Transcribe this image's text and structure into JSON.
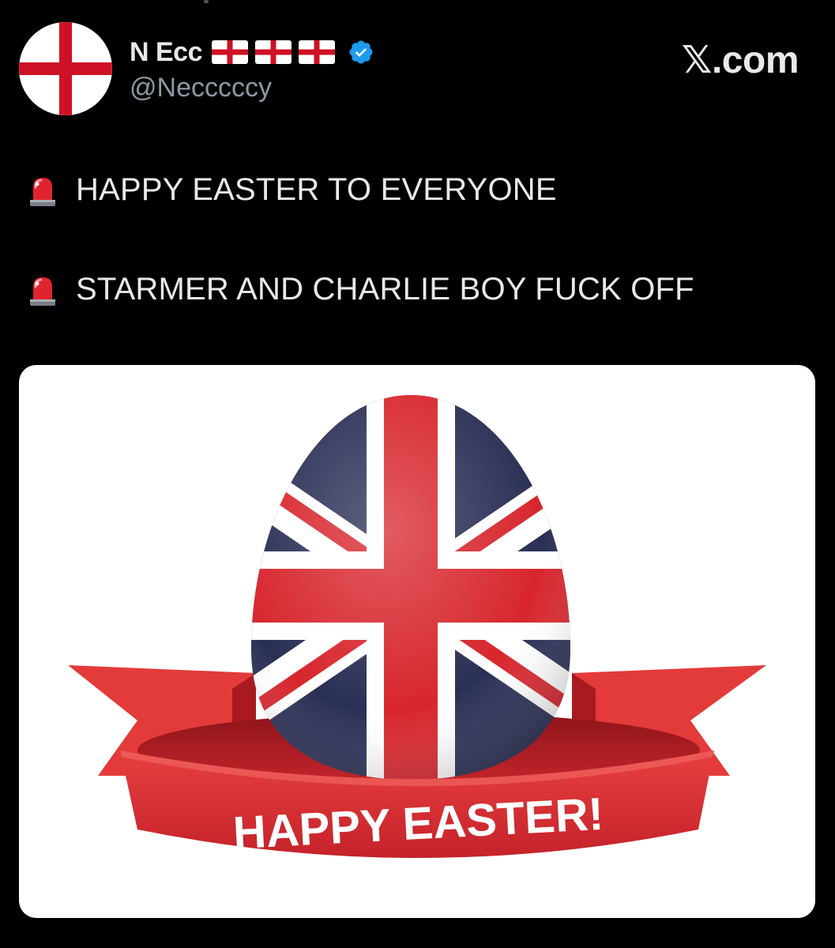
{
  "tweet": {
    "author": {
      "display_name": "N Ecc",
      "handle": "@Necccccy",
      "avatar": "england-flag-avatar",
      "flag_icons": [
        "england-flag-icon",
        "england-flag-icon",
        "england-flag-icon"
      ],
      "verified": true
    },
    "source": "𝕏.com",
    "lines": [
      {
        "icon": "police-siren-icon",
        "text": "HAPPY EASTER TO EVERYONE"
      },
      {
        "icon": "police-siren-icon",
        "text": "STARMER AND CHARLIE BOY FUCK OFF"
      }
    ],
    "media": {
      "banner_text": "HAPPY EASTER!",
      "subject": "union-jack-egg"
    }
  },
  "colors": {
    "background": "#000000",
    "text": "#e7e9ea",
    "secondary_text": "#8b98a5",
    "verified_blue": "#1d9bf0",
    "flag_red": "#ce1124",
    "flag_blue": "#2a2f55"
  }
}
